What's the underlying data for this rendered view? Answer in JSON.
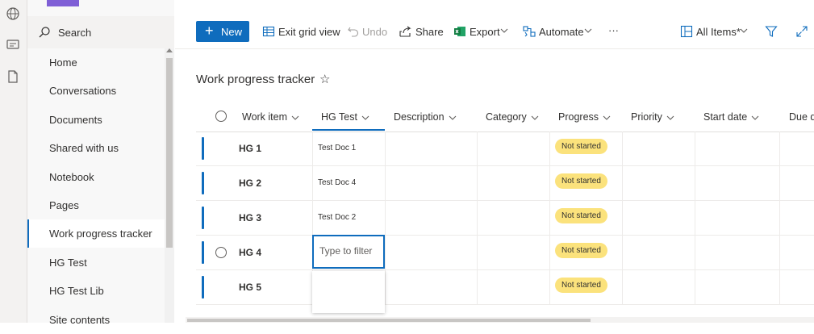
{
  "search": {
    "label": "Search"
  },
  "nav": {
    "items": [
      {
        "label": "Home"
      },
      {
        "label": "Conversations"
      },
      {
        "label": "Documents"
      },
      {
        "label": "Shared with us"
      },
      {
        "label": "Notebook"
      },
      {
        "label": "Pages"
      },
      {
        "label": "Work progress tracker",
        "selected": true
      },
      {
        "label": "HG Test"
      },
      {
        "label": "HG Test Lib"
      },
      {
        "label": "Site contents"
      }
    ]
  },
  "toolbar": {
    "new_label": "New",
    "exit_grid_label": "Exit grid view",
    "undo_label": "Undo",
    "share_label": "Share",
    "export_label": "Export",
    "automate_label": "Automate",
    "more_label": "···",
    "view_label": "All Items*"
  },
  "list": {
    "title": "Work progress tracker",
    "columns": [
      "Work item",
      "HG Test",
      "Description",
      "Category",
      "Progress",
      "Priority",
      "Start date",
      "Due d"
    ],
    "rows": [
      {
        "title": "HG 1",
        "hg_test": "Test Doc 1",
        "progress": "Not started"
      },
      {
        "title": "HG 2",
        "hg_test": "Test Doc 4",
        "progress": "Not started"
      },
      {
        "title": "HG 3",
        "hg_test": "Test Doc 2",
        "progress": "Not started"
      },
      {
        "title": "HG 4",
        "hg_test": "",
        "progress": "Not started"
      },
      {
        "title": "HG 5",
        "hg_test": "",
        "progress": "Not started"
      }
    ],
    "filter_placeholder": "Type to filter"
  },
  "colors": {
    "accent": "#0f6cbd",
    "status_pill": "#fbe27c",
    "brand": "#7f5fd6"
  }
}
